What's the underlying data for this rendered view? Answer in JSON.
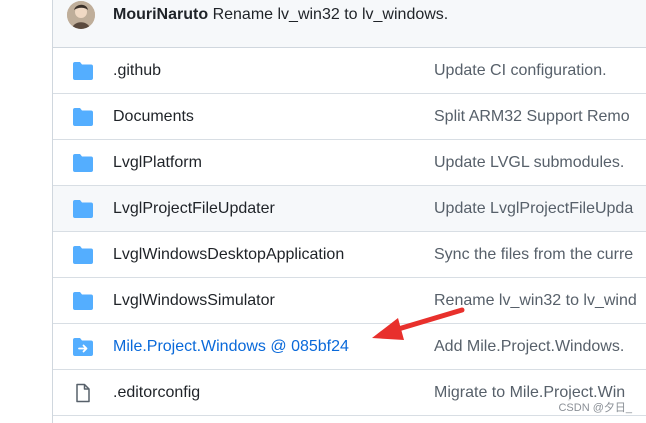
{
  "latest_commit": {
    "author": "MouriNaruto",
    "message": "Rename lv_win32 to lv_windows."
  },
  "files": [
    {
      "name": ".github",
      "type": "folder",
      "commit_message": "Update CI configuration."
    },
    {
      "name": "Documents",
      "type": "folder",
      "commit_message": "Split ARM32 Support Remo"
    },
    {
      "name": "LvglPlatform",
      "type": "folder",
      "commit_message": "Update LVGL submodules."
    },
    {
      "name": "LvglProjectFileUpdater",
      "type": "folder",
      "commit_message": "Update LvglProjectFileUpda"
    },
    {
      "name": "LvglWindowsDesktopApplication",
      "type": "folder",
      "commit_message": "Sync the files from the curre"
    },
    {
      "name": "LvglWindowsSimulator",
      "type": "folder",
      "commit_message": "Rename lv_win32 to lv_wind"
    },
    {
      "name": "Mile.Project.Windows @ 085bf24",
      "type": "submodule",
      "commit_message": "Add Mile.Project.Windows."
    },
    {
      "name": ".editorconfig",
      "type": "file",
      "commit_message": "Migrate to Mile.Project.Win"
    }
  ],
  "watermark": "CSDN @夕日_",
  "colors": {
    "folder": "#54aeff",
    "link": "#0969da",
    "arrow": "#e8302c"
  }
}
